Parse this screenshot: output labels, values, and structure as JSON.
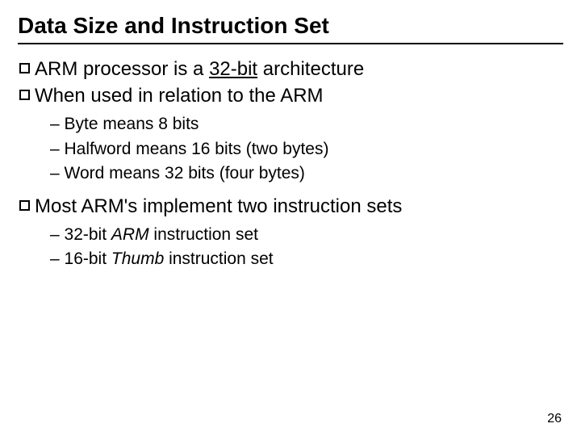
{
  "title": "Data Size and Instruction Set",
  "b1": {
    "i0_pre": "ARM processor is a ",
    "i0_hl": "32-bit",
    "i0_post": " architecture",
    "i1": "When used in relation to the ARM",
    "i2": "Most ARM's implement two instruction sets"
  },
  "b2a": {
    "i0": "Byte means 8 bits",
    "i1": "Halfword means 16 bits (two bytes)",
    "i2": "Word means 32 bits (four bytes)"
  },
  "b2b": {
    "i0_pre": "32-bit ",
    "i0_it": "ARM",
    "i0_post": " instruction set",
    "i1_pre": "16-bit ",
    "i1_it": "Thumb",
    "i1_post": " instruction set"
  },
  "pagenum": "26"
}
